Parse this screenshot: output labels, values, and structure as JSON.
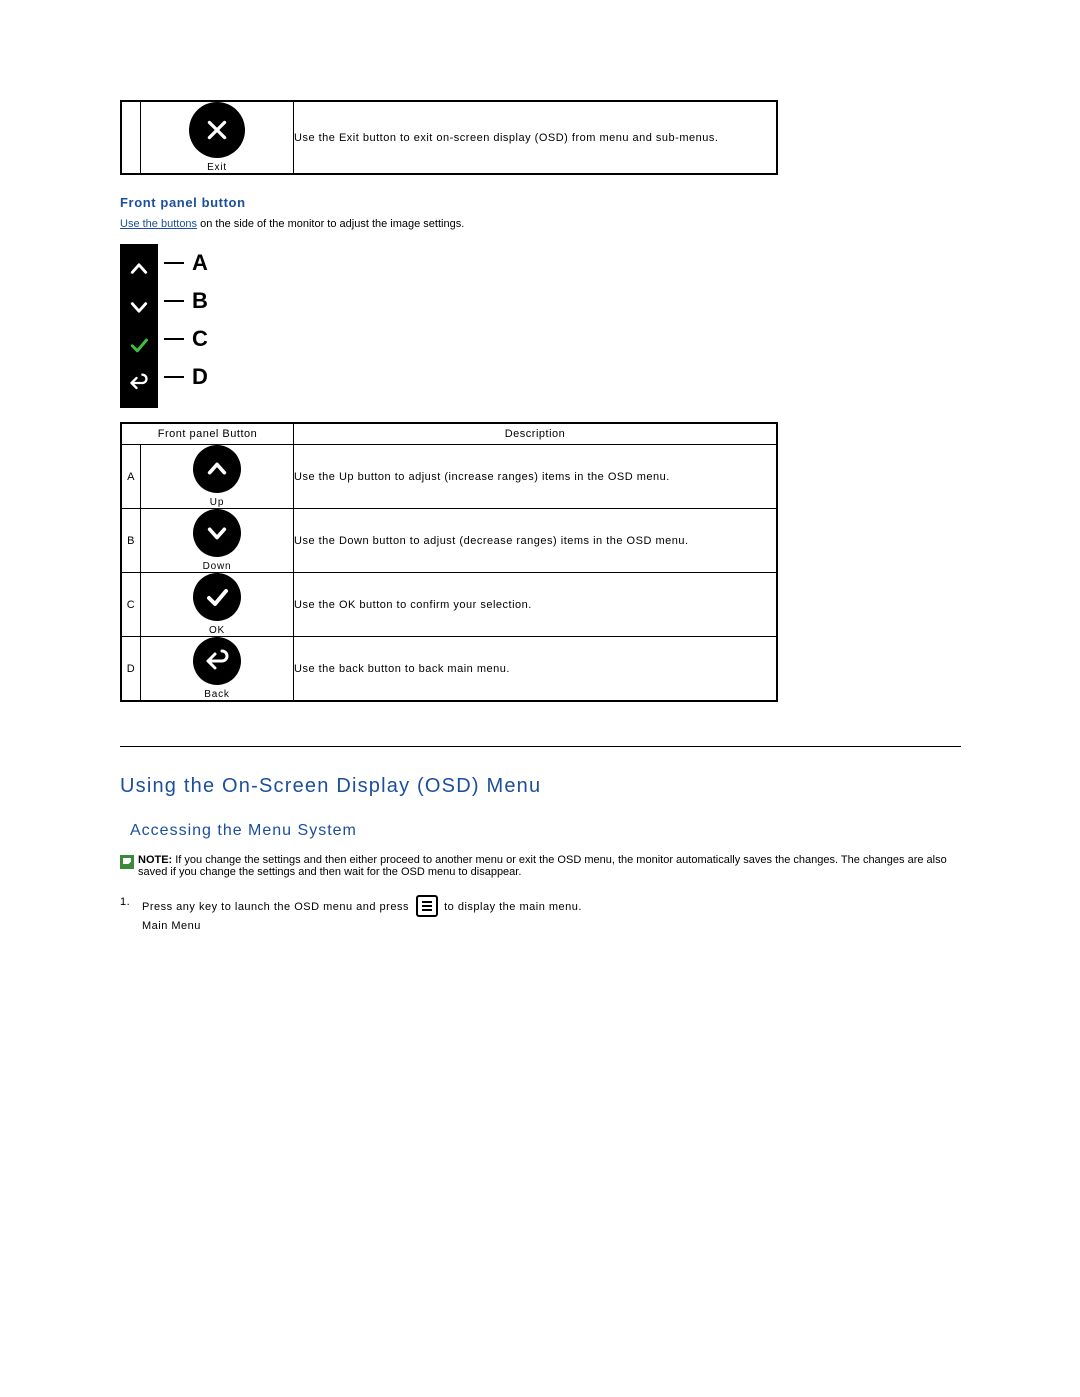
{
  "top_exit_row": {
    "icon_label": "Exit",
    "description": "Use the Exit button to exit on-screen display (OSD) from menu and sub-menus."
  },
  "front_panel_section": {
    "heading": "Front panel button",
    "link_text": "Use the buttons",
    "body_rest": " on the side of the monitor to adjust the image settings.",
    "diagram_labels": [
      "A",
      "B",
      "C",
      "D"
    ]
  },
  "button_table": {
    "col1": "Front panel Button",
    "col2": "Description",
    "rows": [
      {
        "idx": "A",
        "label": "Up",
        "desc": "Use the Up button to adjust (increase ranges) items in the OSD menu."
      },
      {
        "idx": "B",
        "label": "Down",
        "desc": "Use the Down button to adjust (decrease ranges) items in the OSD menu."
      },
      {
        "idx": "C",
        "label": "OK",
        "desc": "Use the OK button to confirm your selection."
      },
      {
        "idx": "D",
        "label": "Back",
        "desc": "Use the back button to back main menu."
      }
    ]
  },
  "osd_section": {
    "heading": "Using the On-Screen Display (OSD) Menu",
    "sub_heading": "Accessing the Menu System",
    "note_label": "NOTE:",
    "note_text": "If you change the settings and then either proceed to another menu or exit the OSD menu, the monitor automatically saves the changes. The changes are also saved if you change the settings and then wait for the OSD menu to disappear.",
    "step_num": "1.",
    "step_text_a": "Press any key to launch the OSD menu and press ",
    "step_text_b": " to display the main menu.",
    "step_extra": "Main Menu"
  }
}
